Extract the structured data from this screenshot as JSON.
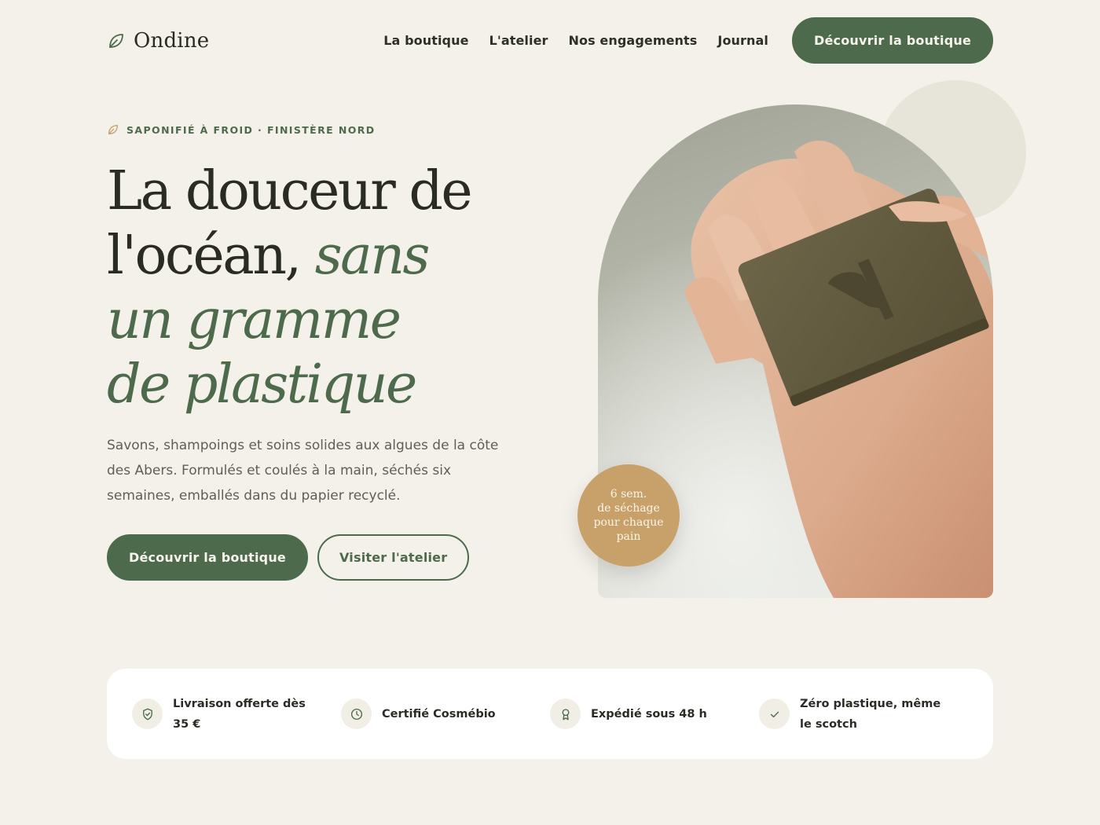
{
  "brand": {
    "name": "Ondine",
    "icon": "leaf-icon"
  },
  "nav": {
    "links": [
      "La boutique",
      "L'atelier",
      "Nos engagements",
      "Journal"
    ],
    "cta": "Découvrir la boutique"
  },
  "hero": {
    "eyebrow": "SAPONIFIÉ À FROID · FINISTÈRE NORD",
    "title": {
      "line1": "La douceur de",
      "line2_plain": "l'océan, ",
      "line2_accent": "sans",
      "line3": "un gramme",
      "line4": "de plastique"
    },
    "subtitle": "Savons, shampoings et soins solides aux algues de la côte des Abers. Formulés et coulés à la main, séchés six semaines, emballés dans du papier recyclé.",
    "cta_primary": "Découvrir la boutique",
    "cta_secondary": "Visiter l'atelier"
  },
  "badge": {
    "line1": "6 sem.",
    "line2": "de séchage",
    "line3": "pour chaque",
    "line4": "pain"
  },
  "features": [
    {
      "icon": "shield-check-icon",
      "label": "Livraison offerte dès 35 €"
    },
    {
      "icon": "clock-icon",
      "label": "Certifié Cosmébio"
    },
    {
      "icon": "award-ribbon-icon",
      "label": "Expédié sous 48 h"
    },
    {
      "icon": "check-icon",
      "label": "Zéro plastique, même le scotch"
    }
  ],
  "colors": {
    "background": "#f4f1ea",
    "accent_green": "#4d6a4c",
    "badge_gold": "#c7a06a",
    "text_dark": "#2a2b25"
  }
}
